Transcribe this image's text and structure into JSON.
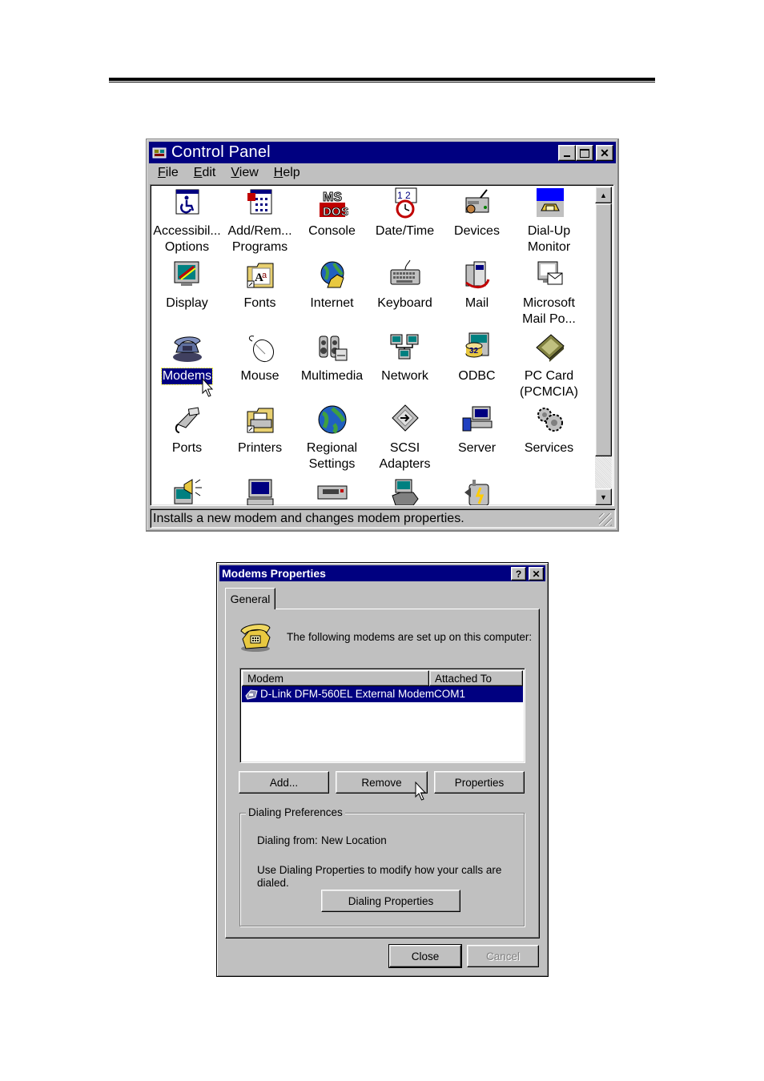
{
  "control_panel": {
    "title": "Control Panel",
    "menu": [
      "File",
      "Edit",
      "View",
      "Help"
    ],
    "items": [
      {
        "label": "Accessibil...\nOptions",
        "icon": "accessibility-icon"
      },
      {
        "label": "Add/Rem...\nPrograms",
        "icon": "add-remove-programs-icon"
      },
      {
        "label": "Console",
        "icon": "console-icon"
      },
      {
        "label": "Date/Time",
        "icon": "date-time-icon"
      },
      {
        "label": "Devices",
        "icon": "devices-icon"
      },
      {
        "label": "Dial-Up\nMonitor",
        "icon": "dial-up-monitor-icon"
      },
      {
        "label": "Display",
        "icon": "display-icon"
      },
      {
        "label": "Fonts",
        "icon": "fonts-icon"
      },
      {
        "label": "Internet",
        "icon": "internet-icon"
      },
      {
        "label": "Keyboard",
        "icon": "keyboard-icon"
      },
      {
        "label": "Mail",
        "icon": "mail-icon"
      },
      {
        "label": "Microsoft\nMail Po...",
        "icon": "microsoft-mail-icon"
      },
      {
        "label": "Modems",
        "icon": "modems-icon",
        "selected": true
      },
      {
        "label": "Mouse",
        "icon": "mouse-icon"
      },
      {
        "label": "Multimedia",
        "icon": "multimedia-icon"
      },
      {
        "label": "Network",
        "icon": "network-icon"
      },
      {
        "label": "ODBC",
        "icon": "odbc-icon"
      },
      {
        "label": "PC Card\n(PCMCIA)",
        "icon": "pc-card-icon"
      },
      {
        "label": "Ports",
        "icon": "ports-icon"
      },
      {
        "label": "Printers",
        "icon": "printers-icon"
      },
      {
        "label": "Regional\nSettings",
        "icon": "regional-settings-icon"
      },
      {
        "label": "SCSI\nAdapters",
        "icon": "scsi-adapters-icon"
      },
      {
        "label": "Server",
        "icon": "server-icon"
      },
      {
        "label": "Services",
        "icon": "services-icon"
      },
      {
        "label": "",
        "icon": "sounds-icon"
      },
      {
        "label": "",
        "icon": "system-icon"
      },
      {
        "label": "",
        "icon": "tape-devices-icon"
      },
      {
        "label": "",
        "icon": "telephony-icon"
      },
      {
        "label": "",
        "icon": "ups-icon"
      }
    ],
    "status_text": "Installs a new modem and changes modem properties."
  },
  "modems_dialog": {
    "title": "Modems Properties",
    "tab": "General",
    "intro": "The following modems are set up on this computer:",
    "columns": [
      "Modem",
      "Attached To"
    ],
    "rows": [
      {
        "modem": "D-Link DFM-560EL External Modem",
        "port": "COM1"
      }
    ],
    "buttons": {
      "add": "Add...",
      "remove": "Remove",
      "properties": "Properties"
    },
    "dialing": {
      "group_label": "Dialing Preferences",
      "from_label": "Dialing from:",
      "from_value": "New Location",
      "hint": "Use Dialing Properties to modify how your calls are",
      "hint2": "dialed.",
      "button": "Dialing Properties"
    },
    "footer": {
      "close": "Close",
      "cancel": "Cancel"
    }
  }
}
